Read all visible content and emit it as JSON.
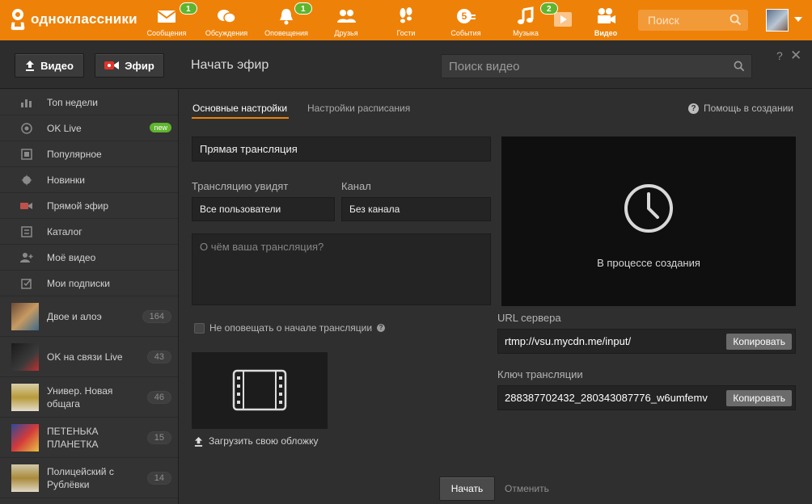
{
  "brand": {
    "name": "одноклассники"
  },
  "nav": [
    {
      "label": "Сообщения",
      "badge": "1",
      "icon": "envelope-icon"
    },
    {
      "label": "Обсуждения",
      "badge": "",
      "icon": "chat-bubbles-icon"
    },
    {
      "label": "Оповещения",
      "badge": "1",
      "icon": "bell-icon"
    },
    {
      "label": "Друзья",
      "badge": "",
      "icon": "friends-icon"
    },
    {
      "label": "Гости",
      "badge": "",
      "icon": "footprints-icon"
    },
    {
      "label": "События",
      "badge": "",
      "icon": "events-icon"
    },
    {
      "label": "Музыка",
      "badge": "",
      "icon": "music-note-icon"
    },
    {
      "label": "",
      "badge": "2",
      "icon": "video-play-icon"
    },
    {
      "label": "Видео",
      "badge": "",
      "icon": "video-camera-icon"
    }
  ],
  "top_search": {
    "placeholder": "Поиск"
  },
  "header": {
    "upload_label": "Видео",
    "live_label": "Эфир",
    "title": "Начать эфир",
    "video_search_placeholder": "Поиск видео",
    "help_symbol": "?",
    "close_symbol": "✕"
  },
  "sidebar": {
    "items": [
      {
        "label": "Топ недели",
        "icon": "bar-chart-icon"
      },
      {
        "label": "OK Live",
        "icon": "ok-live-icon",
        "badge": "new"
      },
      {
        "label": "Популярное",
        "icon": "film-strip-icon"
      },
      {
        "label": "Новинки",
        "icon": "starburst-icon"
      },
      {
        "label": "Прямой эфир",
        "icon": "camera-icon"
      },
      {
        "label": "Каталог",
        "icon": "catalog-icon"
      },
      {
        "label": "Моё видео",
        "icon": "user-plus-icon"
      },
      {
        "label": "Мои подписки",
        "icon": "subscriptions-icon"
      }
    ],
    "channels": [
      {
        "name": "Двое и алоэ",
        "count": "164"
      },
      {
        "name": "OK на связи Live",
        "count": "43"
      },
      {
        "name": "Универ. Новая общага",
        "count": "46"
      },
      {
        "name": "ПЕТЕНЬКА ПЛАНЕТКА",
        "count": "15"
      },
      {
        "name": "Полицейский с Рублёвки",
        "count": "14"
      }
    ]
  },
  "tabs": {
    "basic": "Основные настройки",
    "schedule": "Настройки расписания"
  },
  "help_link": "Помощь в создании",
  "form": {
    "title_value": "Прямая трансляция",
    "audience_label": "Трансляцию увидят",
    "audience_value": "Все пользователи",
    "channel_label": "Канал",
    "channel_value": "Без канала",
    "description_placeholder": "О чём ваша трансляция?",
    "notify_label": "Не оповещать о начале трансляции",
    "upload_cover_label": "Загрузить свою обложку"
  },
  "preview": {
    "status_text": "В процессе создания"
  },
  "server": {
    "url_label": "URL сервера",
    "url_value": "rtmp://vsu.mycdn.me/input/",
    "key_label": "Ключ трансляции",
    "key_value": "288387702432_280343087776_w6umfemv",
    "copy_label": "Копировать"
  },
  "actions": {
    "start_label": "Начать",
    "cancel_label": "Отменить"
  },
  "colors": {
    "accent": "#ee8208",
    "badge_green": "#5fb52d",
    "panel_bg": "#2f2f2f"
  }
}
